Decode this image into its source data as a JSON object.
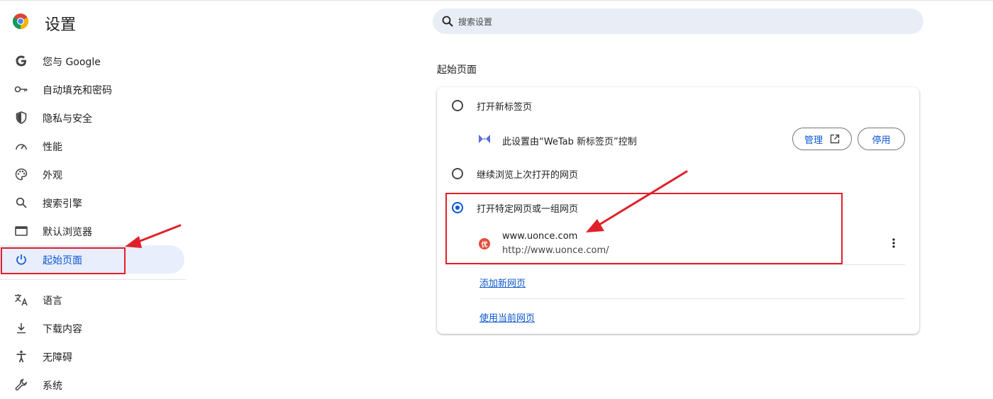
{
  "app": {
    "title": "设置"
  },
  "search": {
    "placeholder": "搜索设置"
  },
  "sidebar": {
    "items": [
      {
        "label": "您与 Google"
      },
      {
        "label": "自动填充和密码"
      },
      {
        "label": "隐私与安全"
      },
      {
        "label": "性能"
      },
      {
        "label": "外观"
      },
      {
        "label": "搜索引擎"
      },
      {
        "label": "默认浏览器"
      },
      {
        "label": "起始页面",
        "active": true
      },
      {
        "label": "语言"
      },
      {
        "label": "下载内容"
      },
      {
        "label": "无障碍"
      },
      {
        "label": "系统"
      }
    ]
  },
  "startup": {
    "section_title": "起始页面",
    "options": [
      {
        "label": "打开新标签页",
        "selected": false
      },
      {
        "label": "继续浏览上次打开的网页",
        "selected": false
      },
      {
        "label": "打开特定网页或一组网页",
        "selected": true
      }
    ],
    "extension_notice": "此设置由“WeTab 新标签页”控制",
    "manage_label": "管理",
    "disable_label": "停用",
    "site": {
      "favicon_text": "优",
      "name": "www.uonce.com",
      "url": "http://www.uonce.com/"
    },
    "add_page_label": "添加新网页",
    "use_current_label": "使用当前网页"
  },
  "colors": {
    "accent": "#0b57d0",
    "annotation": "#e0202a",
    "active_bg": "#e8eefc"
  }
}
